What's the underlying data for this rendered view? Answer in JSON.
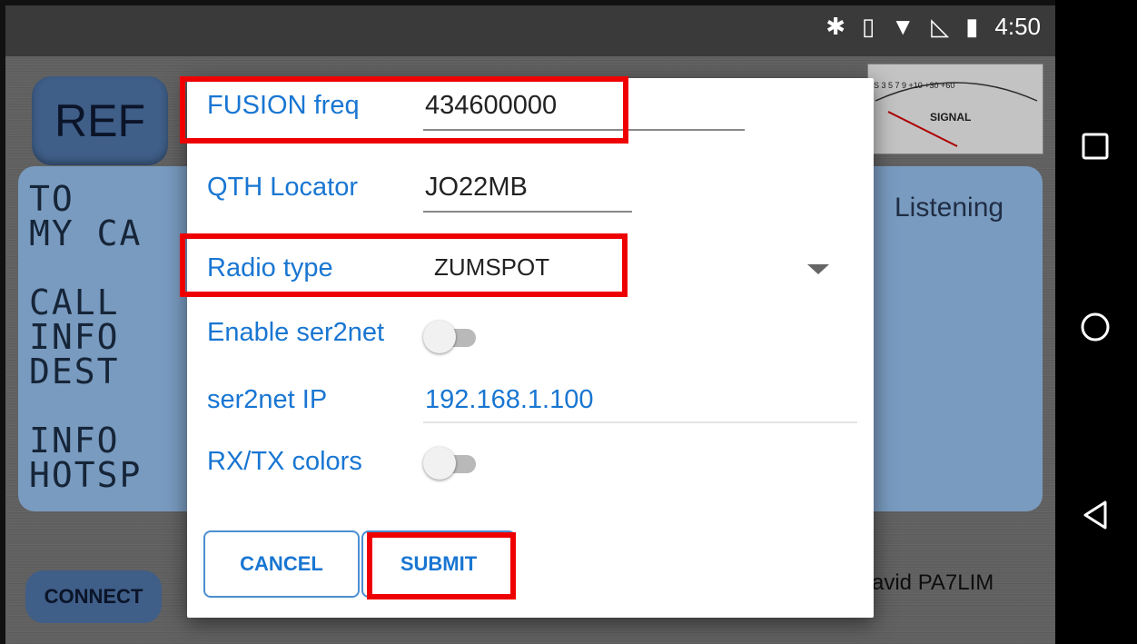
{
  "status": {
    "time": "4:50"
  },
  "background": {
    "ref_label": "REF",
    "lcd_lines": "TO\nMY CA\n\nCALL\nINFO\nDEST\n\nINFO\nHOTSP",
    "listening": "Listening",
    "connect_label": "CONNECT",
    "credit": "avid PA7LIM",
    "meter_label": "SIGNAL",
    "meter_scale": "S  3  5  7  9 +10 +30  +60"
  },
  "dialog": {
    "fusion_freq_label": "FUSION freq",
    "fusion_freq_value": "434600000",
    "qth_label": "QTH Locator",
    "qth_value": "JO22MB",
    "radio_type_label": "Radio type",
    "radio_type_value": "ZUMSPOT",
    "ser2net_label": "Enable ser2net",
    "ser2net_enabled": false,
    "ser2net_ip_label": "ser2net IP",
    "ser2net_ip_value": "192.168.1.100",
    "rxtx_label": "RX/TX colors",
    "rxtx_enabled": false,
    "cancel_label": "CANCEL",
    "submit_label": "SUBMIT"
  },
  "colors": {
    "accent": "#1976d2",
    "highlight": "#ee0000"
  }
}
